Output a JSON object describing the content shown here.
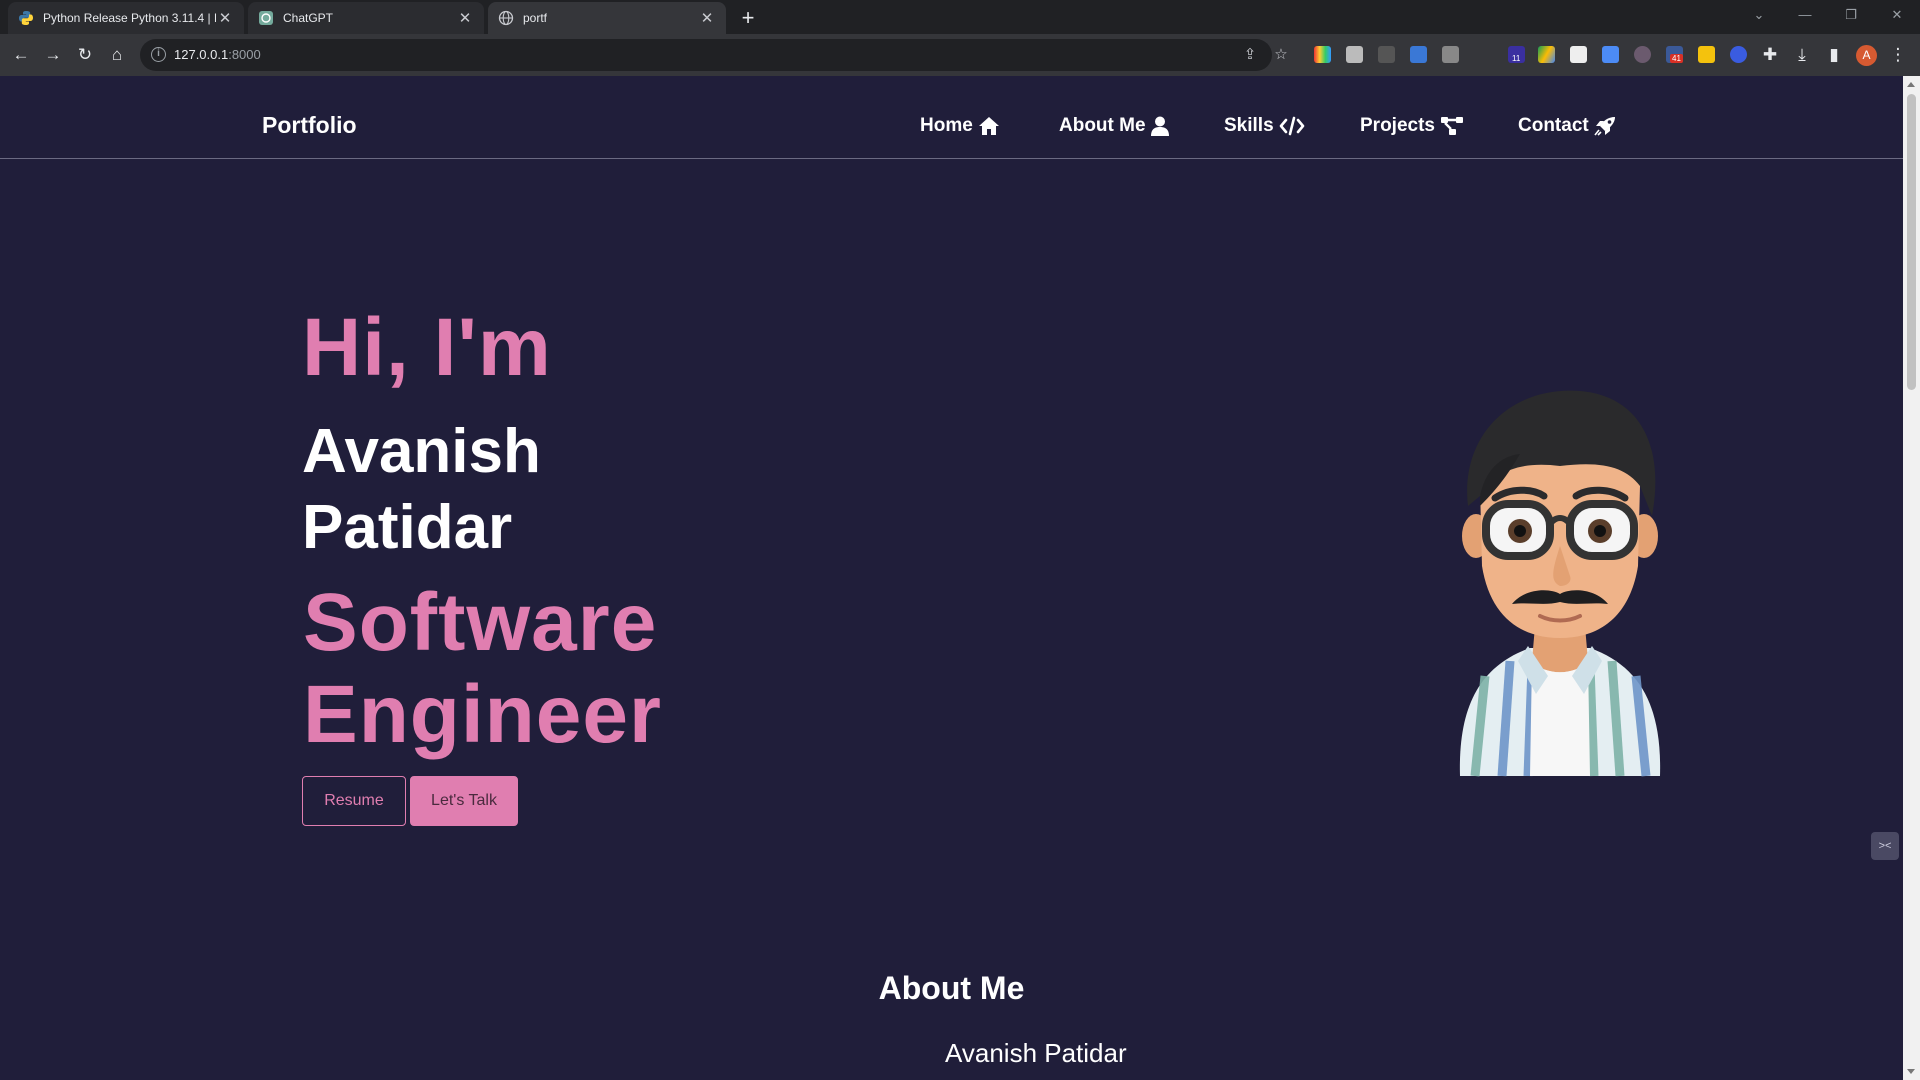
{
  "browser": {
    "tabs": [
      {
        "title": "Python Release Python 3.11.4 | P",
        "favicon": "python-icon"
      },
      {
        "title": "ChatGPT",
        "favicon": "chatgpt-icon"
      },
      {
        "title": "portf",
        "favicon": "globe-icon"
      }
    ],
    "active_tab": 2,
    "url_host": "127.0.0.1",
    "url_port": ":8000",
    "profile_initial": "A",
    "extension_badges": [
      "11",
      "41"
    ]
  },
  "nav": {
    "brand": "Portfolio",
    "links": [
      {
        "label": "Home",
        "icon": "house-icon"
      },
      {
        "label": "About Me",
        "icon": "user-icon"
      },
      {
        "label": "Skills",
        "icon": "code-icon"
      },
      {
        "label": "Projects",
        "icon": "project-diagram-icon"
      },
      {
        "label": "Contact",
        "icon": "rocket-icon"
      }
    ]
  },
  "hero": {
    "greeting": "Hi, I'm",
    "name_line1": "Avanish",
    "name_line2": "Patidar",
    "role_line1": "Software",
    "role_line2": "Engineer",
    "resume_button": "Resume",
    "talk_button": "Let's Talk",
    "avatar": "memoji-avatar"
  },
  "about": {
    "title": "About Me",
    "name": "Avanish Patidar"
  },
  "colors": {
    "page_bg": "#201e3a",
    "accent": "#e07eb0",
    "text": "#ffffff"
  }
}
